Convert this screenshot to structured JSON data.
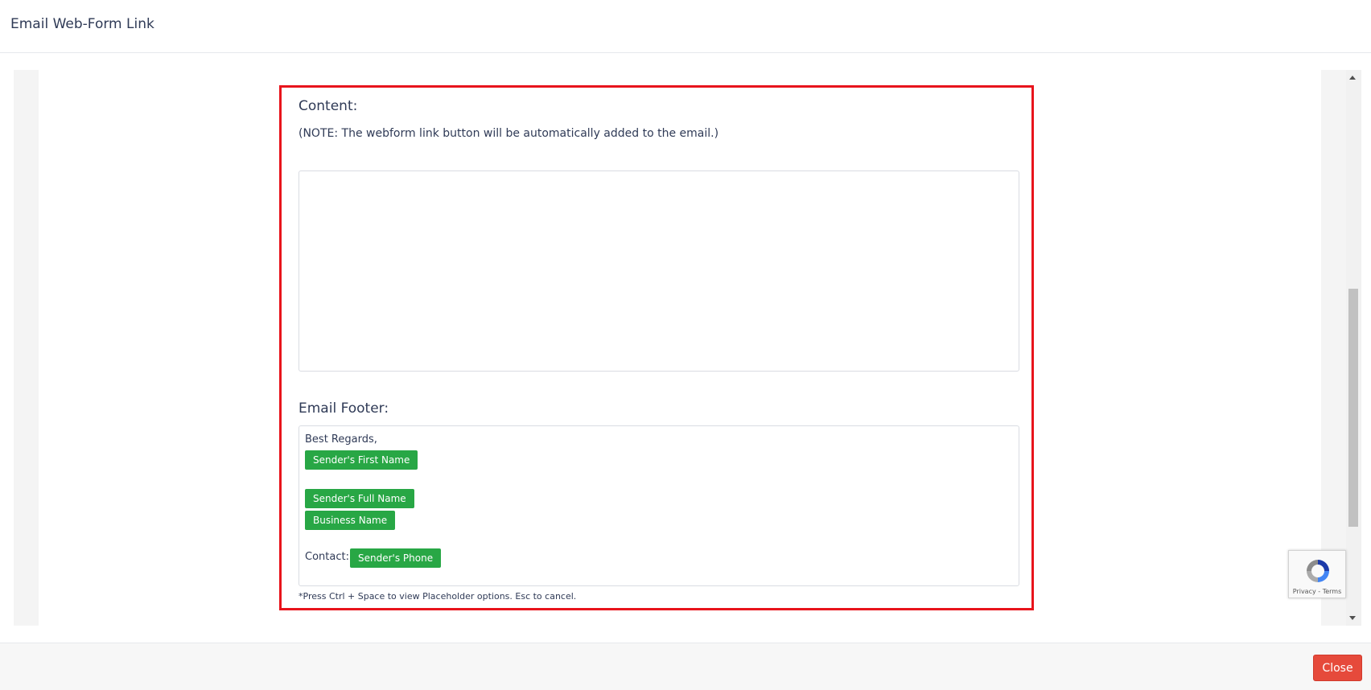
{
  "modal": {
    "title": "Email Web-Form Link"
  },
  "content_section": {
    "label": "Content:",
    "note": "(NOTE: The webform link button will be automatically added to the email.)",
    "editor_value": ""
  },
  "footer_section": {
    "label": "Email Footer:",
    "greeting": "Best Regards,",
    "placeholders": {
      "sender_first_name": "Sender's First Name",
      "sender_full_name": "Sender's Full Name",
      "business_name": "Business Name",
      "sender_phone": "Sender's Phone"
    },
    "contact_label": "Contact:",
    "hint": "*Press Ctrl + Space to view Placeholder options. Esc to cancel."
  },
  "recaptcha": {
    "links": "Privacy - Terms"
  },
  "footer": {
    "close_label": "Close"
  },
  "colors": {
    "highlight": "#e8141c",
    "placeholder_chip": "#28a745",
    "close_button": "#e64a3b"
  }
}
